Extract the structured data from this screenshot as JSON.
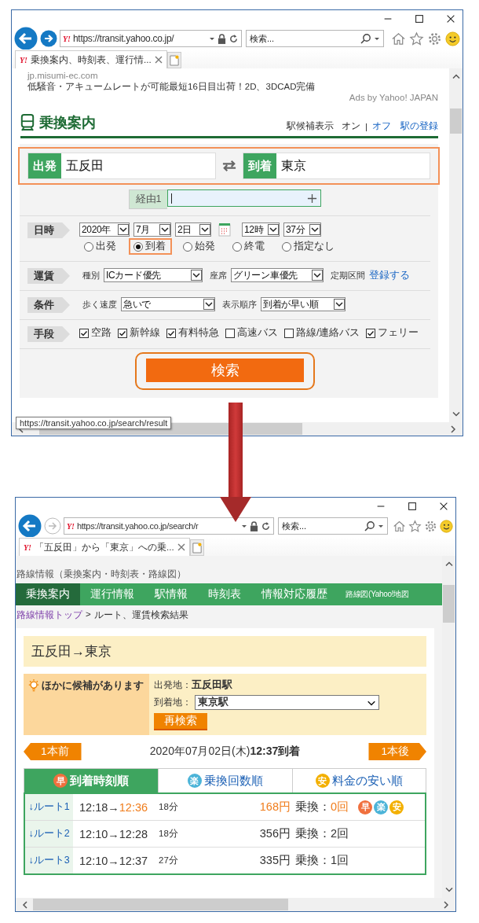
{
  "windows": [
    {
      "forward_enabled": true,
      "address": {
        "logo": "Y!",
        "url": "https://transit.yahoo.co.jp/"
      },
      "search": {
        "placeholder": "検索..."
      },
      "tab": {
        "logo": "Y!",
        "title": "乗換案内、時刻表、運行情..."
      },
      "page": {
        "kind": "search_form",
        "ad": {
          "domain": "jp.misumi-ec.com",
          "text": "低騒音・アキュームレートが可能最短16日目出荷！2D、3DCAD完備",
          "credit": "Ads by Yahoo! JAPAN"
        },
        "header": {
          "title": "乗換案内",
          "hint_label": "駅候補表示",
          "hint_options": [
            {
              "label": "オン",
              "selected": true
            },
            {
              "label": "オフ",
              "selected": false
            }
          ],
          "separator": "|",
          "register_link": "駅の登録"
        },
        "route": {
          "highlighted": true,
          "from": {
            "label": "出発",
            "value": "五反田"
          },
          "to": {
            "label": "到着",
            "value": "東京"
          }
        },
        "via": {
          "label": "経由1"
        },
        "rows": [
          {
            "label": "日時",
            "kind": "datetime",
            "date_selects": [
              "2020年",
              "7月",
              "2日"
            ],
            "time_selects": [
              "12時",
              "37分"
            ],
            "radios": [
              {
                "label": "出発",
                "selected": false,
                "highlighted": false
              },
              {
                "label": "到着",
                "selected": true,
                "highlighted": true
              },
              {
                "label": "始発",
                "selected": false,
                "highlighted": false
              },
              {
                "label": "終電",
                "selected": false,
                "highlighted": false
              },
              {
                "label": "指定なし",
                "selected": false,
                "highlighted": false
              }
            ]
          },
          {
            "label": "運賃",
            "kind": "fields",
            "fields": [
              {
                "label": "種別",
                "value": "ICカード優先"
              },
              {
                "label": "座席",
                "value": "グリーン車優先"
              }
            ],
            "extra_label": "定期区間",
            "link": "登録する"
          },
          {
            "label": "条件",
            "kind": "fields",
            "fields": [
              {
                "label": "歩く速度",
                "value": "急いで"
              },
              {
                "label": "表示順序",
                "value": "到着が早い順"
              }
            ]
          },
          {
            "label": "手段",
            "kind": "checkboxes",
            "options": [
              {
                "label": "空路",
                "checked": true
              },
              {
                "label": "新幹線",
                "checked": true
              },
              {
                "label": "有料特急",
                "checked": true
              },
              {
                "label": "高速バス",
                "checked": false
              },
              {
                "label": "路線/連絡バス",
                "checked": false
              },
              {
                "label": "フェリー",
                "checked": true
              }
            ]
          }
        ],
        "search_button": {
          "label": "検索",
          "highlighted": true
        }
      },
      "status_tooltip": "https://transit.yahoo.co.jp/search/result"
    },
    {
      "forward_enabled": false,
      "address": {
        "logo": "Y!",
        "url": "https://transit.yahoo.co.jp/search/r"
      },
      "search": {
        "placeholder": "検索..."
      },
      "tab": {
        "logo": "Y!",
        "title": "「五反田」から「東京」への乗..."
      },
      "page": {
        "kind": "results",
        "site_title": "路線情報（乗換案内・時刻表・路線図）",
        "nav": [
          {
            "label": "乗換案内",
            "selected": true
          },
          {
            "label": "運行情報",
            "selected": false
          },
          {
            "label": "駅情報",
            "selected": false
          },
          {
            "label": "時刻表",
            "selected": false
          },
          {
            "label": "情報対応履歴",
            "selected": false
          },
          {
            "label": "路線図(Yahoo!地図",
            "selected": false
          }
        ],
        "breadcrumb": {
          "link": "路線情報トップ",
          "separator": ">",
          "current": "ルート、運賃検索結果"
        },
        "title": "五反田→東京",
        "candidates": {
          "notice": "ほかに候補があります",
          "from_label": "出発地：",
          "from_value": "五反田駅",
          "to_label": "到着地：",
          "to_value": "東京駅",
          "button": "再検索"
        },
        "prev": "1本前",
        "datetime": "2020年07月02日(木)**12:37到着**",
        "next": "1本後",
        "sort_tabs": [
          {
            "badge": "早",
            "label": "到着時刻順",
            "color": "#f0703e",
            "selected": true
          },
          {
            "badge": "楽",
            "label": "乗換回数順",
            "color": "#4cb4d8",
            "selected": false
          },
          {
            "badge": "安",
            "label": "料金の安い順",
            "color": "#f3b000",
            "selected": false
          }
        ],
        "routes": [
          {
            "label": "↓ルート1",
            "depart": "12:18",
            "arrow": "→",
            "arrive": "12:36",
            "duration": "18分",
            "fare": "168円",
            "transfer_label": "乗換：",
            "transfers": "0回",
            "best": true,
            "badges": [
              {
                "text": "早",
                "color": "#f0703e"
              },
              {
                "text": "楽",
                "color": "#4cb4d8"
              },
              {
                "text": "安",
                "color": "#f3b000"
              }
            ]
          },
          {
            "label": "↓ルート2",
            "depart": "12:10",
            "arrow": "→",
            "arrive": "12:28",
            "duration": "18分",
            "fare": "356円",
            "transfer_label": "乗換：",
            "transfers": "2回",
            "best": false
          },
          {
            "label": "↓ルート3",
            "depart": "12:10",
            "arrow": "→",
            "arrive": "12:37",
            "duration": "27分",
            "fare": "335円",
            "transfer_label": "乗換：",
            "transfers": "1回",
            "best": false
          }
        ]
      }
    }
  ]
}
